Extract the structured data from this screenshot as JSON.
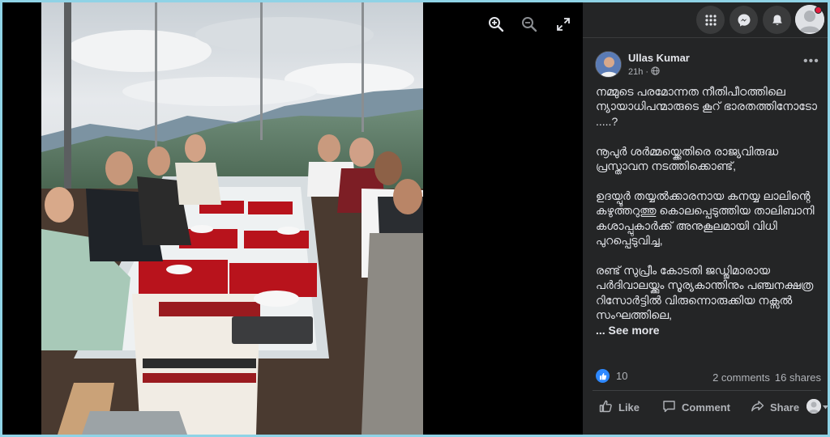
{
  "viewer": {
    "tools": [
      "zoom-in-icon",
      "zoom-out-icon",
      "expand-icon"
    ]
  },
  "topbar": {
    "icons": [
      "menu-grid-icon",
      "messenger-icon",
      "notifications-bell-icon",
      "profile-avatar"
    ]
  },
  "post": {
    "author": "Ullas Kumar",
    "time": "21h",
    "audience_icon": "globe-icon",
    "text": "നമ്മുടെ പരമോന്നത നീതിപീഠത്തിലെ ന്യായാധിപന്മാരുടെ കൂറ് ഭാരതത്തിനോടോ .....?\n\nനൂപുർ ശർമ്മയ്ക്കെതിരെ രാജ്യവിരുദ്ധ പ്രസ്താവന നടത്തിക്കൊണ്ട്,\n\nഉദയ്പൂർ തയ്യൽക്കാരനായ കനയ്യ ലാലിന്റെ കഴുത്തറുത്തു കൊലപ്പെടുത്തിയ താലിബാനി കശാപ്പുകാർക്ക് അനുകൂലമായി വിധി പുറപ്പെടുവിച്ച,\n\nരണ്ട് സുപ്രീം കോടതി ജഡ്ജിമാരായ പർദിവാലയ്ക്കും സൂര്യകാന്തിനും പഞ്ചനക്ഷത്ര റിസോർട്ടിൽ വിരുന്നൊരുക്കിയ നക്സൽ സംഘത്തിലെ,",
    "see_more": "... See more",
    "reaction_count": "10",
    "comments": "2 comments",
    "shares": "16 shares",
    "actions": {
      "like": "Like",
      "comment": "Comment",
      "share": "Share"
    }
  },
  "colors": {
    "panel_bg": "#242526",
    "accent": "#2d88ff",
    "text_primary": "#e4e6eb",
    "text_secondary": "#b0b3b8",
    "frame_border": "#8fd3e6"
  }
}
